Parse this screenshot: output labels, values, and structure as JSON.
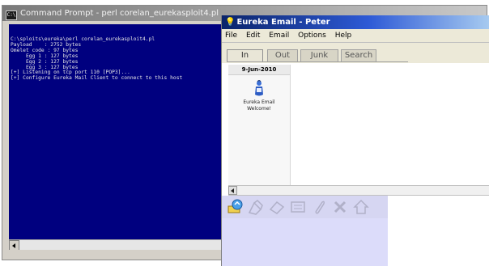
{
  "cmd": {
    "title": "Command Prompt - perl corelan_eurekasploit4.pl",
    "icon": "cmd-icon",
    "lines": [
      "C:\\sploits\\eureka\\perl corelan_eurekasploit4.pl",
      "Payload    : 2752 bytes",
      "Omelet code : 97 bytes",
      "     Egg 1 : 127 bytes",
      "     Egg 2 : 127 bytes",
      "     Egg 3 : 127 bytes",
      "[+] Listening on tcp port 110 [POP3]...",
      "[+] Configure Eureka Mail Client to connect to this host"
    ]
  },
  "email": {
    "title": "Eureka Email - Peter",
    "title_icon": "bulb-icon",
    "menu": [
      "File",
      "Edit",
      "Email",
      "Options",
      "Help"
    ],
    "tabs": [
      {
        "label": "In",
        "active": true
      },
      {
        "label": "Out",
        "active": false
      },
      {
        "label": "Junk",
        "active": false
      },
      {
        "label": "Search",
        "active": false
      }
    ],
    "list": {
      "date": "9-Jun-2010",
      "message_label_line1": "Eureka Email",
      "message_label_line2": "Welcome!"
    },
    "toolbar_icons": [
      "check-mail-icon",
      "compose-icon",
      "erase-icon",
      "address-book-icon",
      "attach-icon",
      "delete-icon",
      "home-icon"
    ],
    "colors": {
      "title_bar": "#0a246a",
      "toolbar_bg": "#d6d6f2",
      "cmd_bg": "#00007f"
    }
  }
}
